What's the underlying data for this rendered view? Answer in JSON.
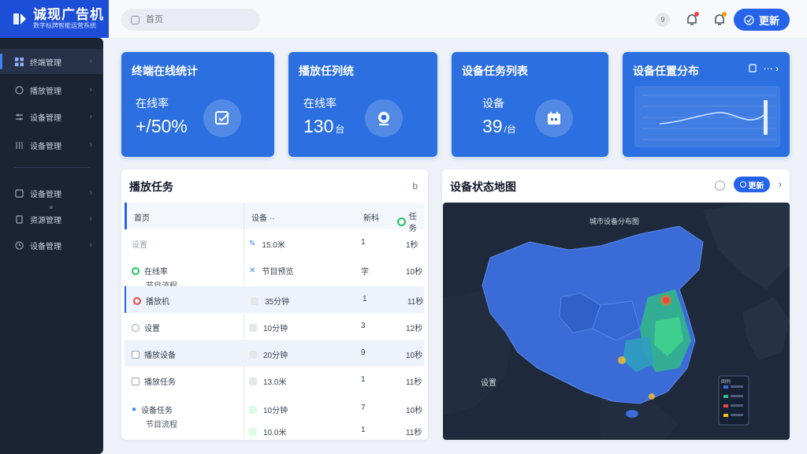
{
  "app": {
    "title": "诚现广告机",
    "subtitle": "数字标牌智能运营系统"
  },
  "sidebar": {
    "items": [
      {
        "label": "终端管理",
        "icon": "grid-icon"
      },
      {
        "label": "播放管理",
        "icon": "chat-icon"
      },
      {
        "label": "设备管理",
        "icon": "settings-icon"
      },
      {
        "label": "设备管理",
        "icon": "sliders-icon"
      },
      {
        "label": "设备管理",
        "icon": "box-icon"
      },
      {
        "label": "资源管理",
        "icon": "file-icon"
      },
      {
        "label": "设备管理",
        "icon": "clock-icon"
      }
    ]
  },
  "topbar": {
    "search_placeholder": "首页",
    "badge": "9",
    "button_label": "更新"
  },
  "cards": [
    {
      "title": "终端在线统计",
      "label": "在线率",
      "value": "+/50%"
    },
    {
      "title": "播放任列统",
      "label": "在线率",
      "value": "130",
      "unit": "台"
    },
    {
      "title": "设备任务列表",
      "label": "设备",
      "value": "39",
      "unit": "/台"
    },
    {
      "title": "设备任置分布",
      "tools": "⋯ ›"
    }
  ],
  "tasks": {
    "title": "播放任务",
    "header_icon": "b",
    "columns": [
      "首页",
      "设备 ··",
      "新科",
      "任务"
    ],
    "rows": [
      {
        "c1": "设置",
        "c2": "15.0米",
        "c3": "1",
        "c4": "1秒"
      },
      {
        "c1": "在线率",
        "sub": "节目流程",
        "c2": "节目预览",
        "c3": "字",
        "c4": "10秒"
      },
      {
        "c1": "播放机",
        "c2": "35分钟",
        "c3": "1",
        "c4": "11秒"
      },
      {
        "c1": "设置",
        "c2": "10分钟",
        "c3": "3",
        "c4": "12秒"
      },
      {
        "c1": "播放设备",
        "c2": "20分钟",
        "c3": "9",
        "c4": "10秒"
      },
      {
        "c1": "播放任务",
        "c2": "13.0米",
        "c3": "1",
        "c4": "11秒"
      },
      {
        "c1": "设备任务",
        "sub": "节目流程",
        "c2": "10分钟",
        "c3": "7",
        "c4": "10秒"
      },
      {
        "c1": "",
        "c2": "10.0米",
        "c3": "1",
        "c4": "11秒"
      }
    ]
  },
  "map": {
    "title": "设备状态地图",
    "button_label": "更新",
    "caption": "城市设备分布图",
    "label_left": "设置",
    "legend_title": "图例"
  },
  "colors": {
    "accent": "#2563eb",
    "card": "#2b6fe0",
    "sidebar": "#1b2433",
    "map_bg": "#1e2a3b",
    "map_land": "#3a6bd6",
    "map_hot": "#3ecf8e"
  }
}
